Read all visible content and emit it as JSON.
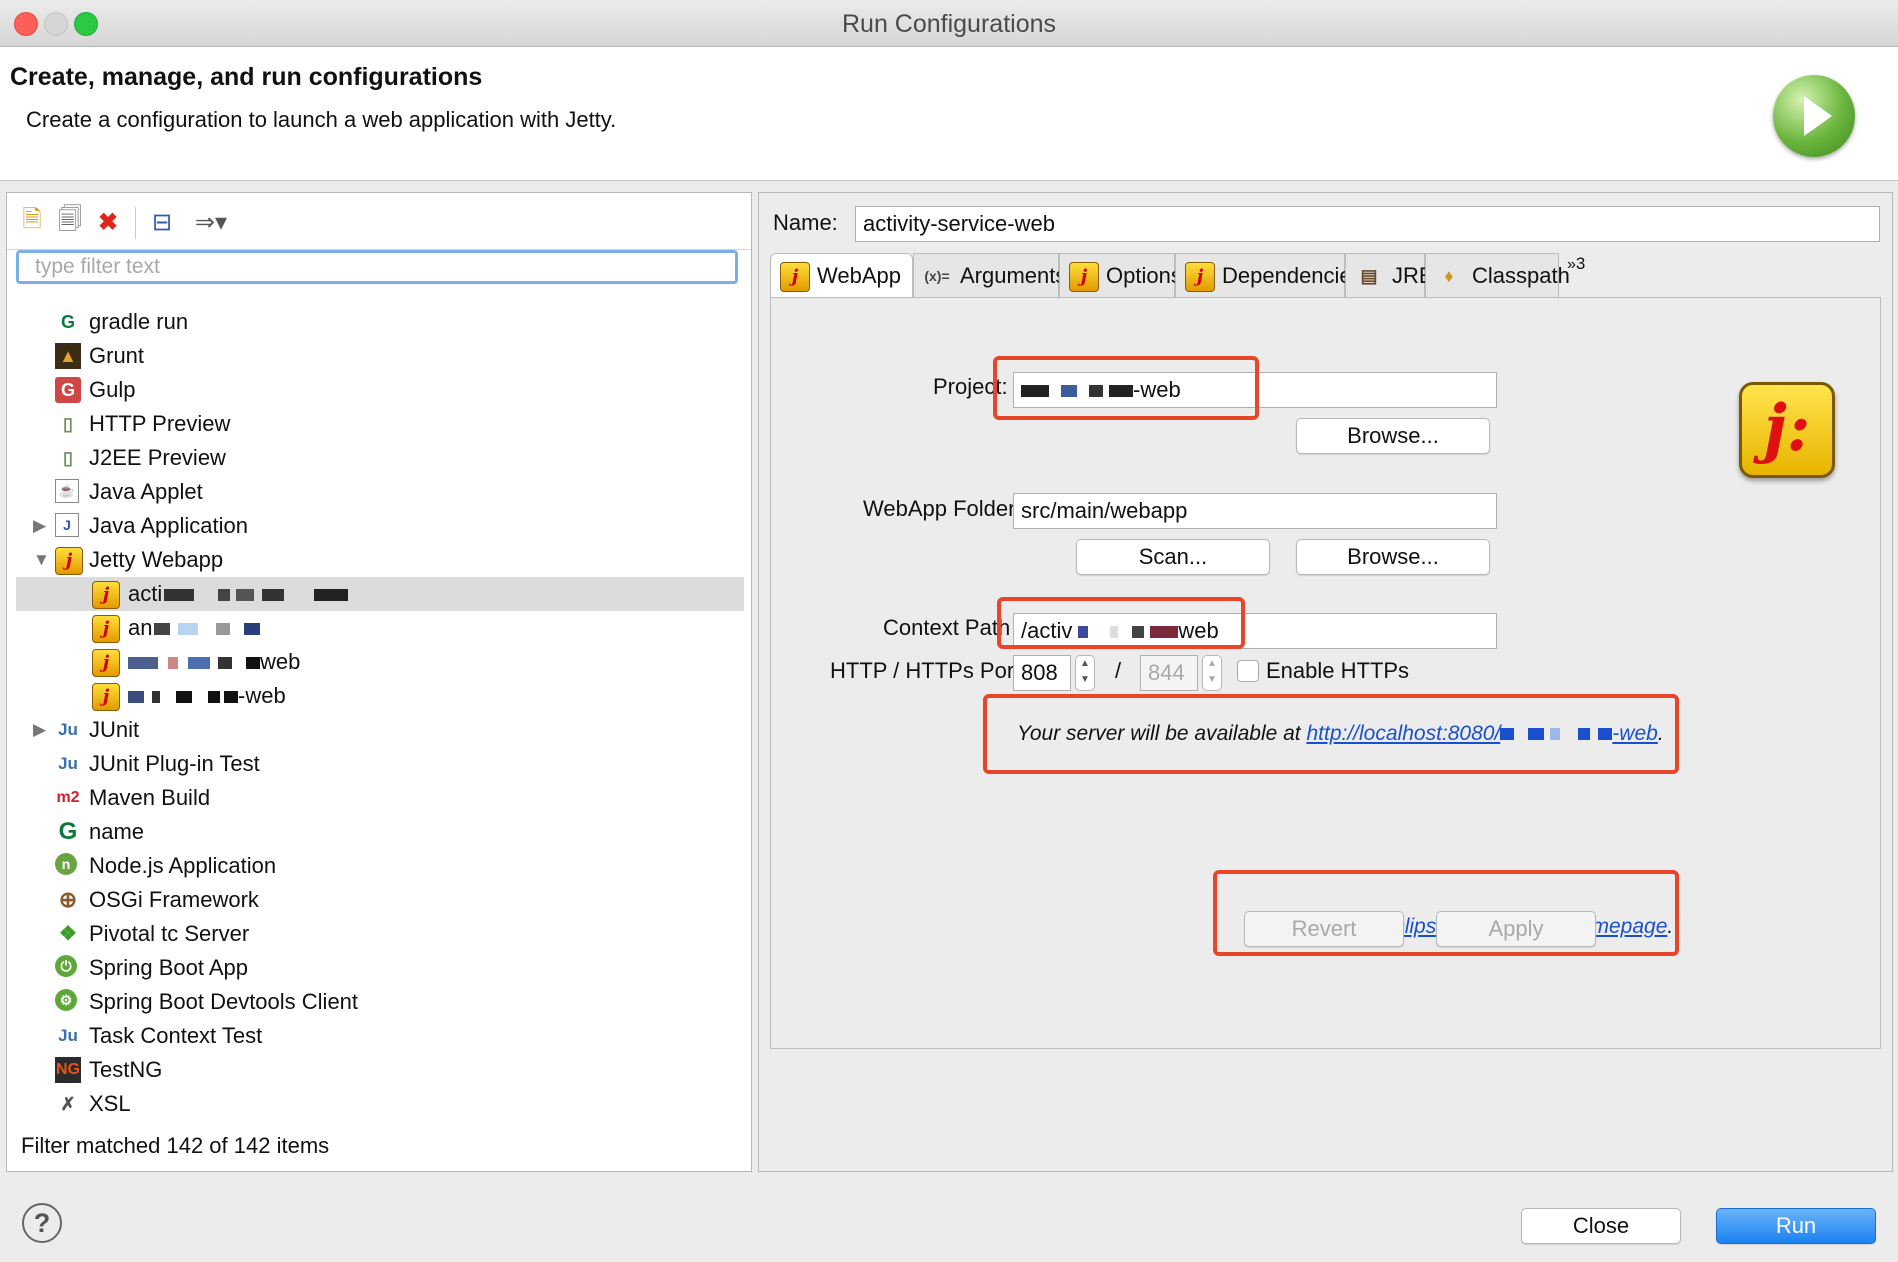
{
  "window": {
    "title": "Run Configurations"
  },
  "header": {
    "title": "Create, manage, and run configurations",
    "subtitle": "Create a configuration to launch a web application with Jetty.",
    "icon": "run-icon"
  },
  "left": {
    "toolbar": [
      "new-config-icon",
      "duplicate-icon",
      "delete-icon",
      "collapse-all-icon",
      "filter-icon"
    ],
    "filter_placeholder": "type filter text",
    "tree": [
      {
        "label": "gradle run",
        "icon": "gradle-icon"
      },
      {
        "label": "Grunt",
        "icon": "grunt-icon"
      },
      {
        "label": "Gulp",
        "icon": "gulp-icon"
      },
      {
        "label": "HTTP Preview",
        "icon": "http-preview-icon"
      },
      {
        "label": "J2EE Preview",
        "icon": "j2ee-preview-icon"
      },
      {
        "label": "Java Applet",
        "icon": "java-applet-icon"
      },
      {
        "label": "Java Application",
        "icon": "java-application-icon"
      },
      {
        "label": "Jetty Webapp",
        "icon": "jetty-icon"
      },
      {
        "label": "acti",
        "icon": "jetty-icon"
      },
      {
        "label": "an",
        "icon": "jetty-icon"
      },
      {
        "label": "web",
        "icon": "jetty-icon"
      },
      {
        "label": "-web",
        "icon": "jetty-icon"
      },
      {
        "label": "JUnit",
        "icon": "junit-icon"
      },
      {
        "label": "JUnit Plug-in Test",
        "icon": "junit-plugin-icon"
      },
      {
        "label": "Maven Build",
        "icon": "maven-icon"
      },
      {
        "label": "name",
        "icon": "gradle-name-icon"
      },
      {
        "label": "Node.js Application",
        "icon": "nodejs-icon"
      },
      {
        "label": "OSGi Framework",
        "icon": "osgi-icon"
      },
      {
        "label": "Pivotal tc Server",
        "icon": "pivotal-icon"
      },
      {
        "label": "Spring Boot App",
        "icon": "spring-boot-icon"
      },
      {
        "label": "Spring Boot Devtools Client",
        "icon": "spring-devtools-icon"
      },
      {
        "label": "Task Context Test",
        "icon": "task-context-icon"
      },
      {
        "label": "TestNG",
        "icon": "testng-icon"
      },
      {
        "label": "XSL",
        "icon": "xsl-icon"
      }
    ],
    "status": "Filter matched 142 of 142 items"
  },
  "right": {
    "name_label": "Name:",
    "name_value": "activity-service-web",
    "tabs": [
      "WebApp",
      "Arguments",
      "Options",
      "Dependencies",
      "JRE",
      "Classpath"
    ],
    "tab_overflow": "3",
    "project_label": "Project:",
    "project_value": "-web",
    "browse_label": "Browse...",
    "webapp_folder_label": "WebApp Folder:",
    "webapp_folder_value": "src/main/webapp",
    "scan_label": "Scan...",
    "context_path_label": "Context Path",
    "context_path_prefix": "/activ",
    "context_path_suffix": "web",
    "ports_label": "HTTP / HTTPs Port:",
    "http_port": "808",
    "port_separator": "/",
    "https_port": "844",
    "enable_https_label": "Enable HTTPs",
    "server_text": "Your server will be available at ",
    "server_link_prefix": "http://localhost:8080/",
    "server_link_suffix": "-web",
    "period": ".",
    "homepage_prefix": "the ",
    "homepage_link": "Eclipse Jetty Plugin homepage",
    "revert_label": "Revert",
    "apply_label": "Apply"
  },
  "footer": {
    "close_label": "Close",
    "run_label": "Run"
  }
}
